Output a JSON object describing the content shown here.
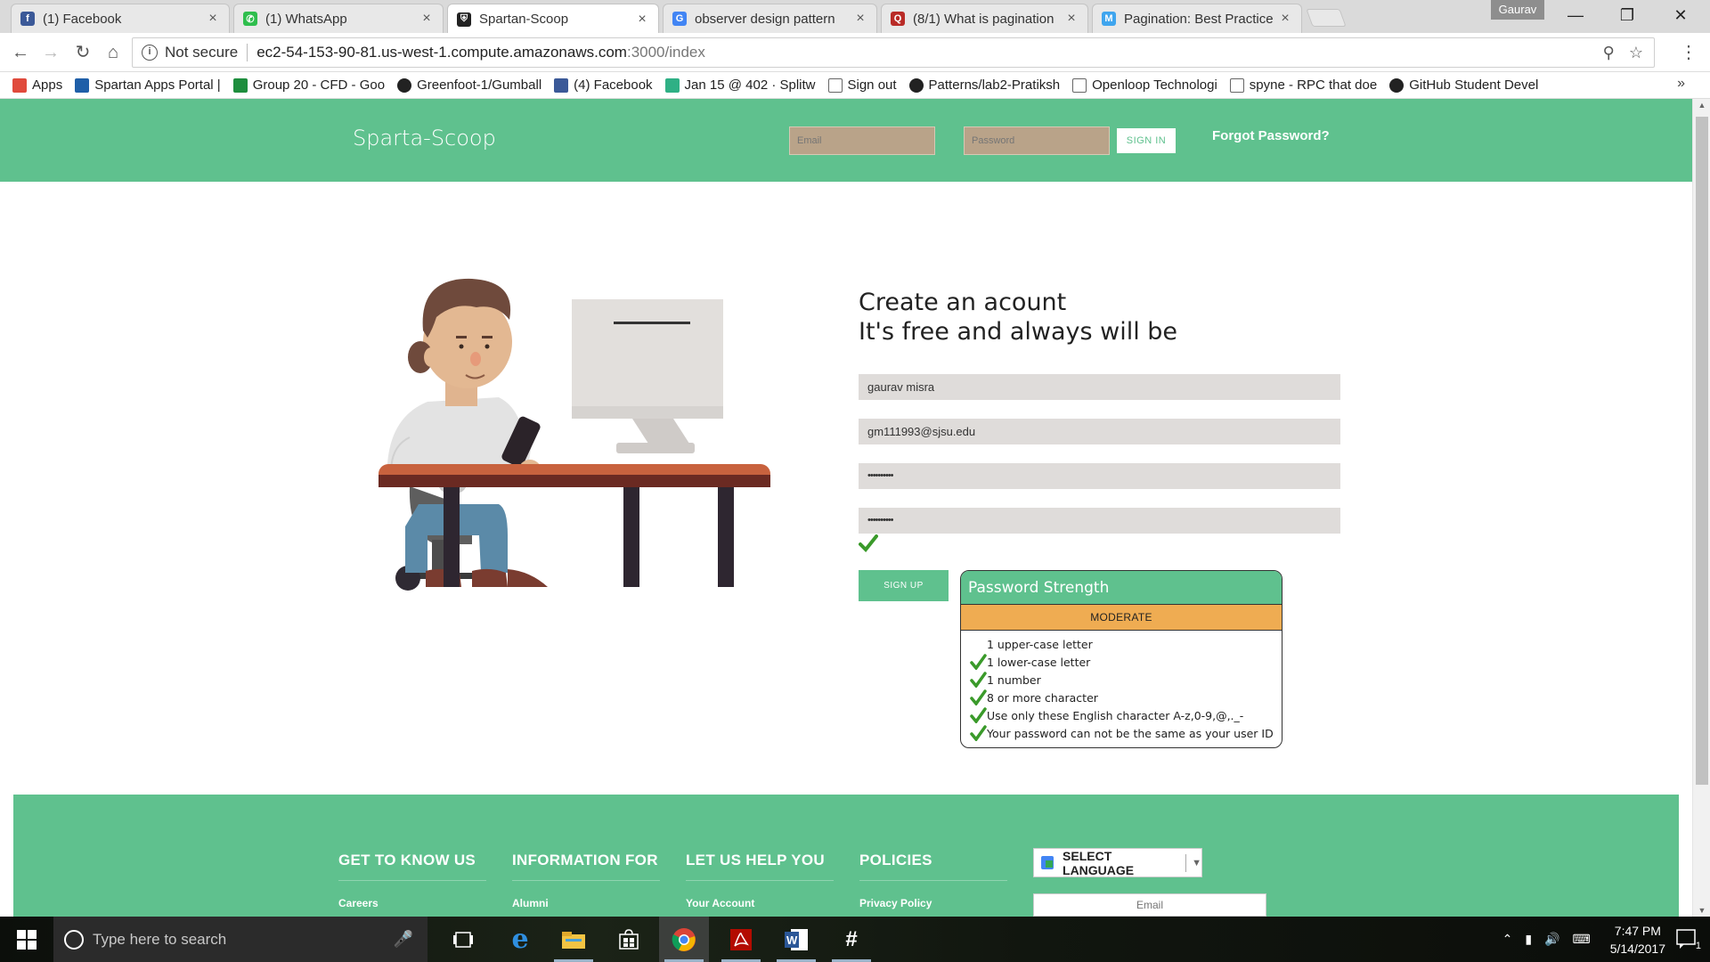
{
  "browser": {
    "tabs": [
      {
        "title": "(1) Facebook",
        "icon": "facebook-icon",
        "color": "#3b5998",
        "glyph": "f"
      },
      {
        "title": "(1) WhatsApp",
        "icon": "whatsapp-icon",
        "color": "#2fbe4d",
        "glyph": "✆"
      },
      {
        "title": "Spartan-Scoop",
        "icon": "spartan-helmet-icon",
        "color": "#222222",
        "glyph": "⛨",
        "active": true
      },
      {
        "title": "observer design pattern",
        "icon": "google-icon",
        "color": "#4285f4",
        "glyph": "G"
      },
      {
        "title": "(8/1) What is pagination",
        "icon": "quora-icon",
        "color": "#b92b27",
        "glyph": "Q"
      },
      {
        "title": "Pagination: Best Practice",
        "icon": "medium-icon",
        "color": "#3fa5ee",
        "glyph": "M"
      }
    ],
    "user_chip": "Gaurav",
    "security_label": "Not secure",
    "url_host": "ec2-54-153-90-81.us-west-1.compute.amazonaws.com",
    "url_path": ":3000/index",
    "bookmarks": [
      {
        "label": "Apps",
        "icon": "apps-grid-icon",
        "color": "#e04a3c"
      },
      {
        "label": "Spartan Apps Portal |",
        "icon": "spartan-icon",
        "color": "#1f5fa8"
      },
      {
        "label": "Group 20 - CFD - Goo",
        "icon": "sheets-icon",
        "color": "#1e8e3e"
      },
      {
        "label": "Greenfoot-1/Gumball",
        "icon": "github-icon",
        "color": "#222222"
      },
      {
        "label": "(4) Facebook",
        "icon": "facebook-icon",
        "color": "#3b5998"
      },
      {
        "label": "Jan 15 @ 402 · Splitw",
        "icon": "splitwise-icon",
        "color": "#2fb085"
      },
      {
        "label": "Sign out",
        "icon": "page-icon",
        "color": "#ffffff"
      },
      {
        "label": "Patterns/lab2-Pratiksh",
        "icon": "github-icon",
        "color": "#222222"
      },
      {
        "label": "Openloop Technologi",
        "icon": "page-icon",
        "color": "#ffffff"
      },
      {
        "label": "spyne - RPC that doe",
        "icon": "page-icon",
        "color": "#ffffff"
      },
      {
        "label": "GitHub Student Devel",
        "icon": "github-icon",
        "color": "#222222"
      }
    ]
  },
  "header": {
    "brand": "Sparta-Scoop",
    "email_placeholder": "Email",
    "password_placeholder": "Password",
    "signin_label": "SIGN IN",
    "forgot_label": "Forgot Password?"
  },
  "signup": {
    "title_line1": "Create an acount",
    "title_line2": "It's free and always will be",
    "name_value": "gaurav misra",
    "email_value": "gm111993@sjsu.edu",
    "password_mask": "••••••••••",
    "confirm_mask": "••••••••••",
    "button_label": "SIGN UP"
  },
  "password_strength": {
    "title": "Password Strength",
    "level": "MODERATE",
    "level_color": "#efac52",
    "rules": [
      {
        "text": "1 upper-case letter",
        "met": false
      },
      {
        "text": "1 lower-case letter",
        "met": true
      },
      {
        "text": "1 number",
        "met": true
      },
      {
        "text": "8 or more character",
        "met": true
      },
      {
        "text": "Use only these English character A-z,0-9,@,._-",
        "met": true
      },
      {
        "text": "Your password can not be the same as your user ID",
        "met": true
      }
    ]
  },
  "footer": {
    "columns": [
      {
        "heading": "GET TO KNOW US",
        "first_link": "Careers"
      },
      {
        "heading": "INFORMATION FOR",
        "first_link": "Alumni"
      },
      {
        "heading": "LET US HELP YOU",
        "first_link": "Your Account"
      },
      {
        "heading": "POLICIES",
        "first_link": "Privacy Policy"
      }
    ],
    "language_label": "SELECT LANGUAGE",
    "email_placeholder": "Email"
  },
  "taskbar": {
    "search_placeholder": "Type here to search",
    "time": "7:47 PM",
    "date": "5/14/2017",
    "notification_count": "1"
  },
  "colors": {
    "accent": "#5fc18e",
    "moderate": "#efac52"
  }
}
